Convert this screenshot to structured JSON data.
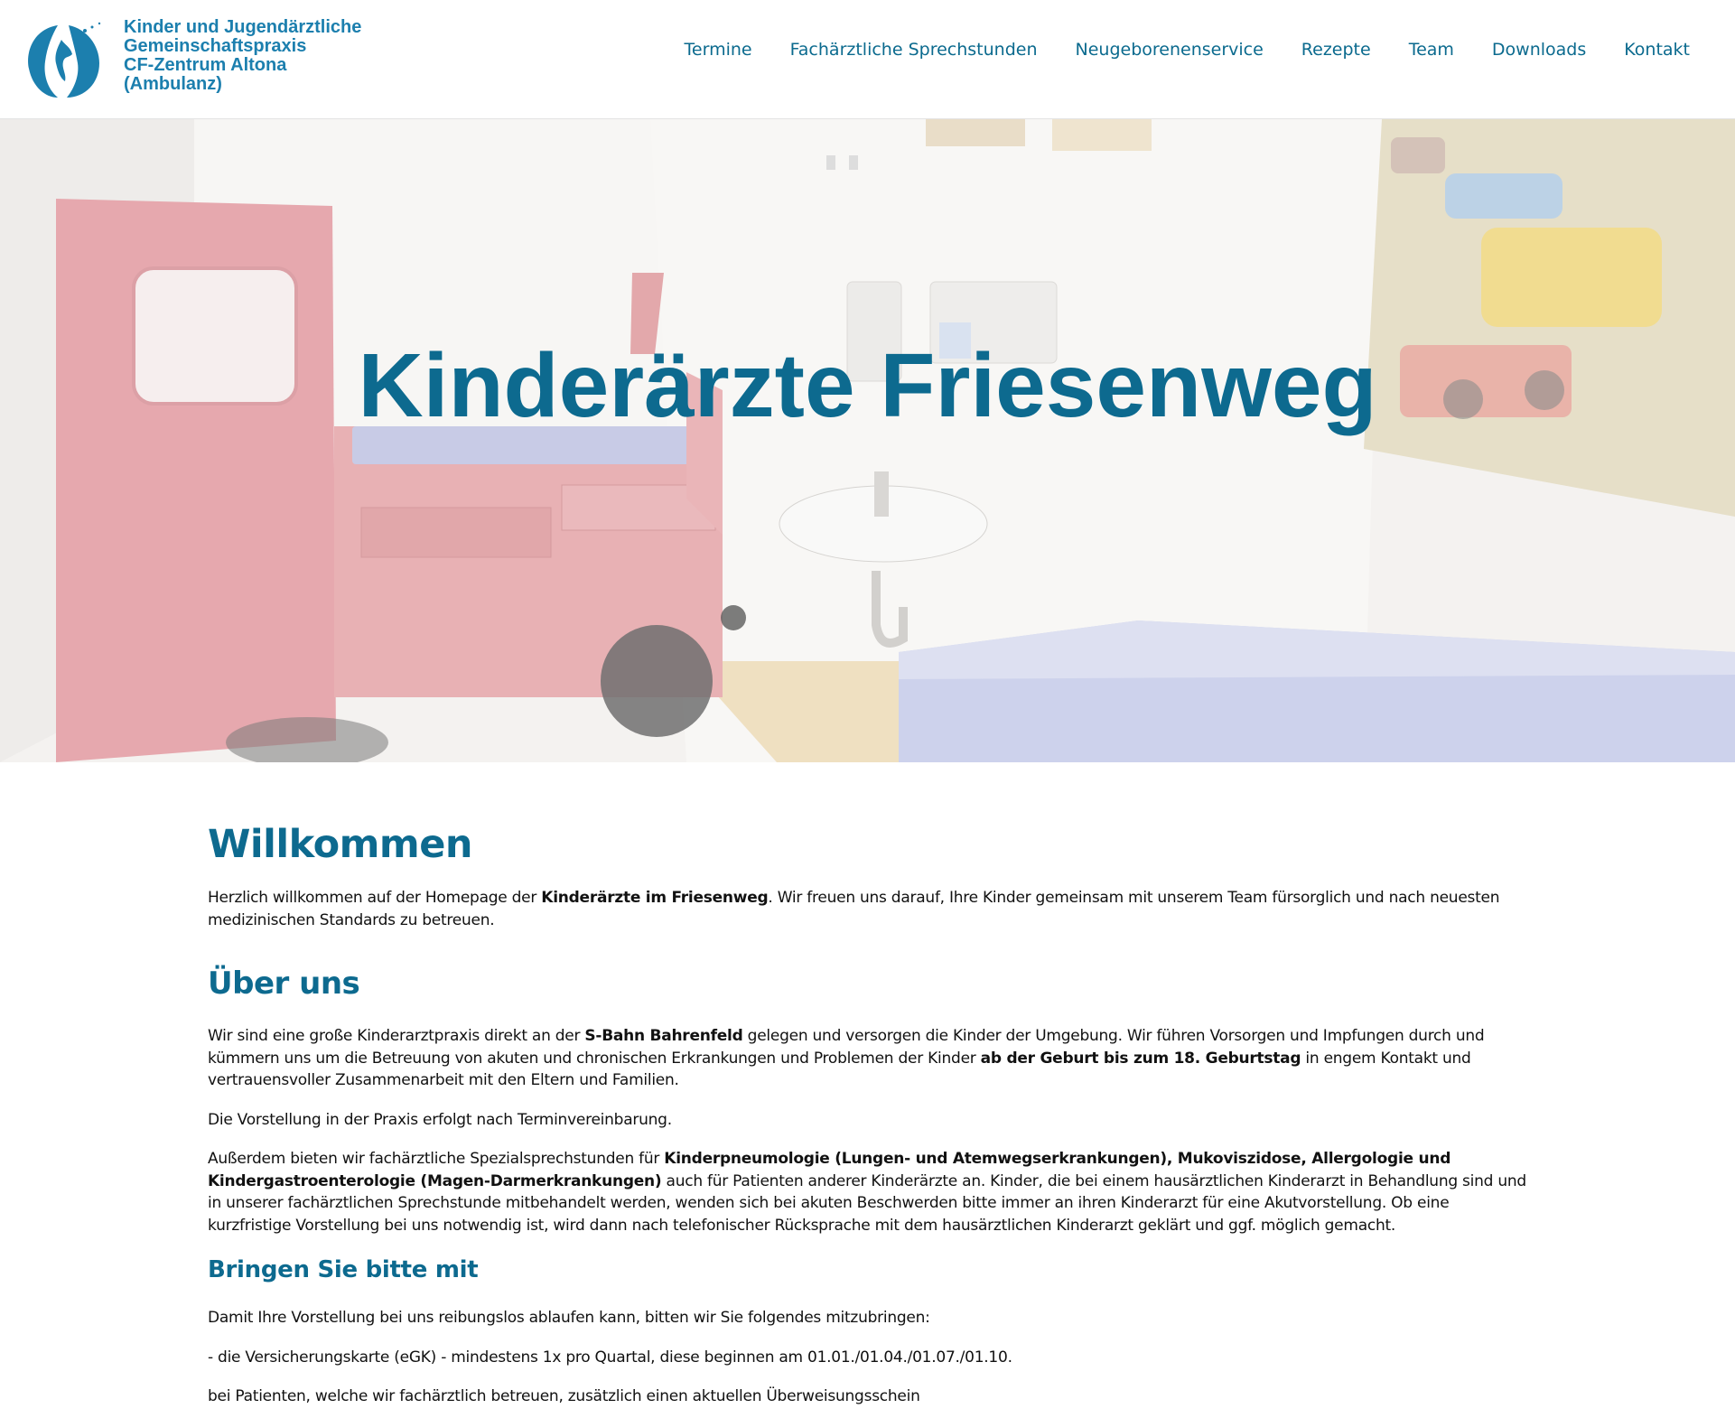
{
  "colors": {
    "brand": "#0d6a8f",
    "logo": "#1c7fae",
    "text": "#111111"
  },
  "header": {
    "logo_lines": [
      "Kinder und Jugendärztliche",
      "Gemeinschaftspraxis",
      "CF-Zentrum Altona",
      "(Ambulanz)"
    ],
    "nav": [
      "Termine",
      "Fachärztliche Sprechstunden",
      "Neugeborenenservice",
      "Rezepte",
      "Team",
      "Downloads",
      "Kontakt"
    ]
  },
  "hero": {
    "title": "Kinderärzte Friesenweg"
  },
  "main": {
    "welcome_heading": "Willkommen",
    "welcome_p": {
      "a": "Herzlich willkommen auf der Homepage der ",
      "b": "Kinderärzte im Friesenweg",
      "c": ". Wir freuen uns darauf, Ihre Kinder gemeinsam mit unserem Team fürsorglich und nach neuesten medizinischen Standards zu betreuen."
    },
    "about_heading": "Über uns",
    "about_p1": {
      "a": "Wir sind eine große Kinderarztpraxis direkt an der ",
      "b": "S-Bahn Bahrenfeld",
      "c": " gelegen und versorgen die Kinder der Umgebung. Wir führen Vorsorgen und Impfungen durch und kümmern uns um die Betreuung von akuten und chronischen Erkrankungen und Problemen der Kinder ",
      "d": "ab der Geburt bis zum 18. Geburtstag",
      "e": " in engem Kontakt und vertrauensvoller Zusammenarbeit mit den Eltern und Familien."
    },
    "about_p2": "Die Vorstellung in der Praxis erfolgt nach Terminvereinbarung.",
    "about_p3": {
      "a": "Außerdem bieten wir fachärztliche Spezialsprechstunden für ",
      "b": "Kinderpneumologie (Lungen- und Atemwegserkrankungen), Mukoviszidose, Allergologie und Kindergastroenterologie (Magen-Darmerkrankungen)",
      "c": " auch für Patienten anderer Kinderärzte an. Kinder, die bei einem hausärztlichen Kinderarzt in Behandlung sind und in unserer fachärztlichen Sprechstunde mitbehandelt werden, wenden sich bei akuten Beschwerden bitte immer an ihren Kinderarzt für eine Akutvorstellung. Ob eine kurzfristige Vorstellung bei uns notwendig ist, wird dann nach telefonischer Rücksprache mit dem hausärztlichen Kinderarzt geklärt und ggf. möglich gemacht."
    },
    "bring_heading": "Bringen Sie bitte mit",
    "bring_p1": "Damit Ihre Vorstellung bei uns reibungslos ablaufen kann, bitten wir Sie folgendes mitzubringen:",
    "bring_p2": "- die Versicherungskarte (eGK) - mindestens 1x pro Quartal, diese beginnen am 01.01./01.04./01.07./01.10.",
    "bring_p3": "bei Patienten, welche wir fachärztlich betreuen, zusätzlich einen aktuellen Überweisungsschein"
  }
}
